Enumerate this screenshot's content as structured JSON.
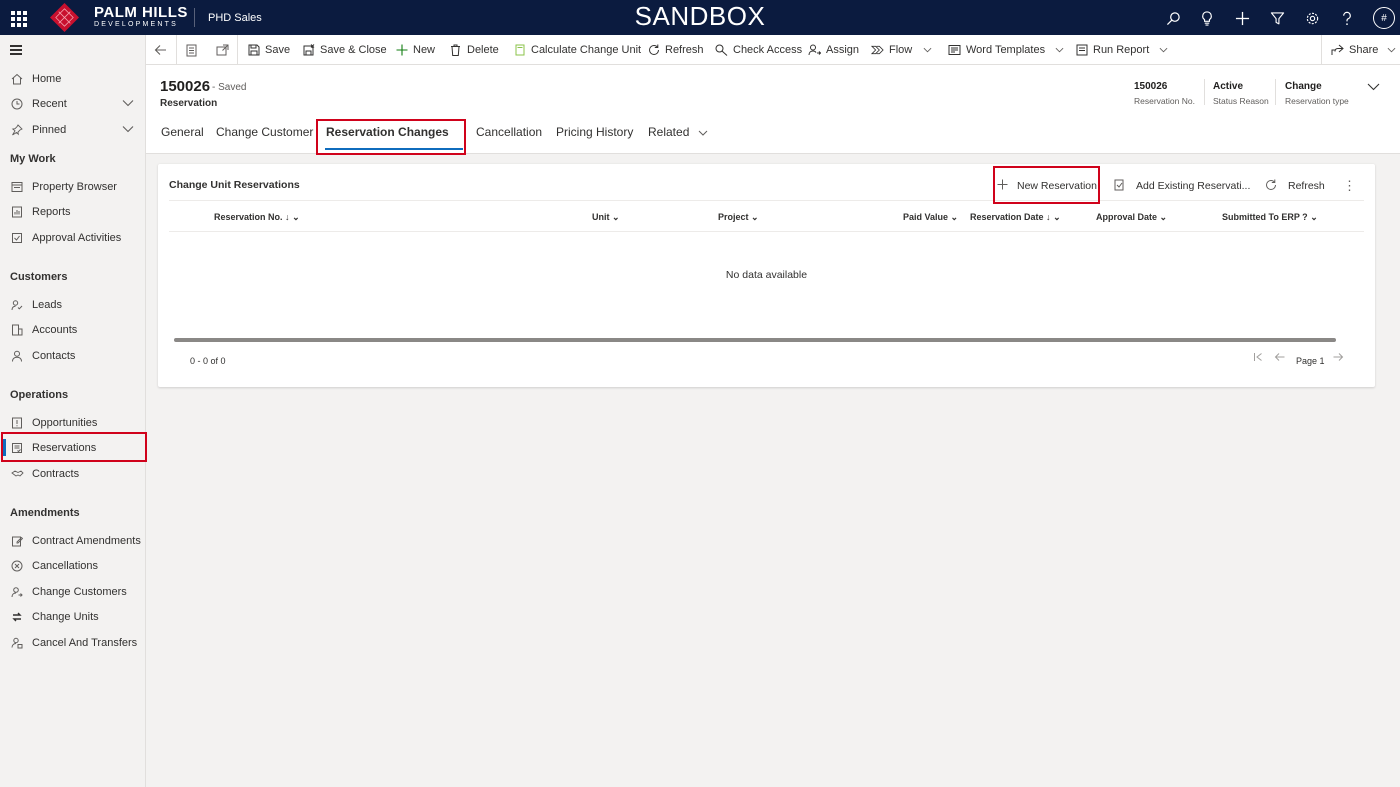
{
  "header": {
    "logo_line1": "PALM HILLS",
    "logo_line2": "DEVELOPMENTS",
    "app_name": "PHD Sales",
    "environment": "SANDBOX",
    "avatar_initial": "#",
    "icons": [
      "search-icon",
      "lightbulb-icon",
      "plus-icon",
      "filter-icon",
      "settings-icon",
      "help-icon"
    ]
  },
  "sidebar": {
    "top_items": [
      {
        "label": "Home",
        "icon": "home-icon"
      },
      {
        "label": "Recent",
        "icon": "clock-icon"
      },
      {
        "label": "Pinned",
        "icon": "pin-icon"
      }
    ],
    "sections": [
      {
        "title": "My Work",
        "items": [
          {
            "label": "Property Browser",
            "icon": "browser-icon"
          },
          {
            "label": "Reports",
            "icon": "report-icon"
          },
          {
            "label": "Approval Activities",
            "icon": "activity-icon"
          }
        ]
      },
      {
        "title": "Customers",
        "items": [
          {
            "label": "Leads",
            "icon": "leads-icon"
          },
          {
            "label": "Accounts",
            "icon": "accounts-icon"
          },
          {
            "label": "Contacts",
            "icon": "contacts-icon"
          }
        ]
      },
      {
        "title": "Operations",
        "items": [
          {
            "label": "Opportunities",
            "icon": "opportunity-icon"
          },
          {
            "label": "Reservations",
            "icon": "reservation-icon"
          },
          {
            "label": "Contracts",
            "icon": "contract-icon"
          }
        ]
      },
      {
        "title": "Amendments",
        "items": [
          {
            "label": "Contract Amendments",
            "icon": "amendment-icon"
          },
          {
            "label": "Cancellations",
            "icon": "cancel-icon"
          },
          {
            "label": "Change Customers",
            "icon": "change-customer-icon"
          },
          {
            "label": "Change Units",
            "icon": "change-unit-icon"
          },
          {
            "label": "Cancel And Transfers",
            "icon": "transfer-icon"
          }
        ]
      }
    ],
    "active_item": "Reservations"
  },
  "commandbar": {
    "save": "Save",
    "save_close": "Save & Close",
    "new": "New",
    "delete": "Delete",
    "calc_change_unit": "Calculate Change Unit",
    "refresh": "Refresh",
    "check_access": "Check Access",
    "assign": "Assign",
    "flow": "Flow",
    "word_templates": "Word Templates",
    "run_report": "Run Report",
    "share": "Share"
  },
  "record": {
    "title": "150026",
    "saved_status": "- Saved",
    "entity": "Reservation",
    "header_fields": [
      {
        "value": "150026",
        "label": "Reservation No."
      },
      {
        "value": "Active",
        "label": "Status Reason"
      },
      {
        "value": "Change",
        "label": "Reservation type"
      }
    ],
    "tabs": [
      "General",
      "Change Customer",
      "Reservation Changes",
      "Cancellation",
      "Pricing History",
      "Related"
    ],
    "active_tab": "Reservation Changes"
  },
  "subgrid": {
    "title": "Change Unit Reservations",
    "commands": {
      "new": "New Reservation",
      "add_existing": "Add Existing Reservati...",
      "refresh": "Refresh"
    },
    "columns": [
      "Reservation No.",
      "Unit",
      "Project",
      "Paid Value",
      "Reservation Date",
      "Approval Date",
      "Submitted To ERP ?"
    ],
    "empty_message": "No data available",
    "count": "0 - 0 of 0",
    "page": "Page 1"
  },
  "colors": {
    "header_bg": "#0b1b3f",
    "accent": "#0f6cbd",
    "highlight": "#d0021b",
    "logo": "#c8102e"
  }
}
